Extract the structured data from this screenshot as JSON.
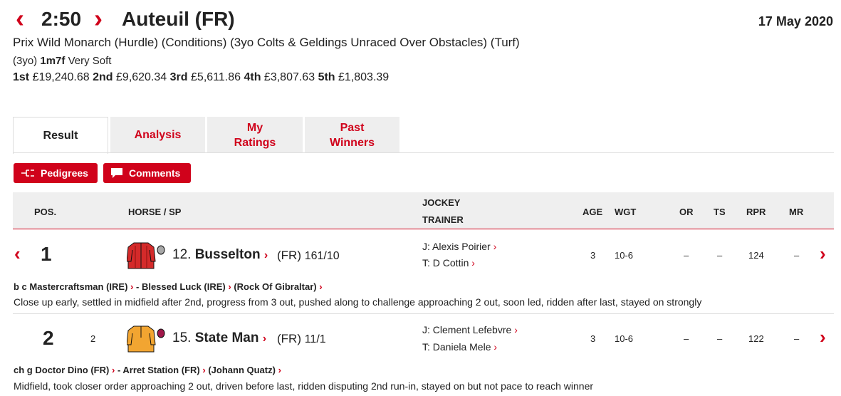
{
  "header": {
    "prev_icon": "chevron-left-icon",
    "time": "2:50",
    "next_icon": "chevron-right-icon",
    "course": "Auteuil (FR)",
    "date": "17 May 2020",
    "race_name": "Prix Wild Monarch (Hurdle) (Conditions) (3yo Colts & Geldings Unraced Over Obstacles) (Turf)",
    "age_class": "(3yo)",
    "distance": "1m7f",
    "going": "Very Soft",
    "prizes": [
      {
        "place": "1st",
        "amount": "£19,240.68"
      },
      {
        "place": "2nd",
        "amount": "£9,620.34"
      },
      {
        "place": "3rd",
        "amount": "£5,611.86"
      },
      {
        "place": "4th",
        "amount": "£3,807.63"
      },
      {
        "place": "5th",
        "amount": "£1,803.39"
      }
    ]
  },
  "tabs": [
    {
      "label": "Result",
      "active": true
    },
    {
      "label": "Analysis",
      "active": false
    },
    {
      "label": "My Ratings",
      "active": false
    },
    {
      "label": "Past Winners",
      "active": false
    }
  ],
  "buttons": {
    "pedigrees": "Pedigrees",
    "comments": "Comments"
  },
  "table": {
    "headers": {
      "pos": "POS.",
      "horse": "HORSE / SP",
      "jockey": "JOCKEY",
      "trainer": "TRAINER",
      "age": "AGE",
      "wgt": "WGT",
      "or": "OR",
      "ts": "TS",
      "rpr": "RPR",
      "mr": "MR"
    },
    "rows": [
      {
        "pos": "1",
        "distance": "",
        "number": "12.",
        "name": "Busselton",
        "country": "(FR)",
        "sp": "161/10",
        "jockey": "J: Alexis Poirier",
        "trainer": "T: D Cottin",
        "age": "3",
        "wgt": "10-6",
        "or": "–",
        "ts": "–",
        "rpr": "124",
        "mr": "–",
        "silk_colors": {
          "body": "#d42a2a",
          "cap": "#a8a8a8"
        },
        "pedigree": {
          "sire_prefix": "b c",
          "sire": "Mastercraftsman (IRE)",
          "dam": "- Blessed Luck (IRE)",
          "damsire": "(Rock Of Gibraltar)"
        },
        "comment": "Close up early, settled in midfield after 2nd, progress from 3 out, pushed along to challenge approaching 2 out, soon led, ridden after last, stayed on strongly"
      },
      {
        "pos": "2",
        "distance": "2",
        "number": "15.",
        "name": "State Man",
        "country": "(FR)",
        "sp": "11/1",
        "jockey": "J: Clement Lefebvre",
        "trainer": "T: Daniela Mele",
        "age": "3",
        "wgt": "10-6",
        "or": "–",
        "ts": "–",
        "rpr": "122",
        "mr": "–",
        "silk_colors": {
          "body": "#f2a531",
          "cap": "#a0184a"
        },
        "pedigree": {
          "sire_prefix": "ch g",
          "sire": "Doctor Dino (FR)",
          "dam": "- Arret Station (FR)",
          "damsire": "(Johann Quatz)"
        },
        "comment": "Midfield, took closer order approaching 2 out, driven before last, ridden disputing 2nd run-in, stayed on but not pace to reach winner"
      }
    ]
  },
  "colors": {
    "accent": "#d0021b",
    "tab_bg": "#eeeeee",
    "header_bg": "#efefef"
  }
}
